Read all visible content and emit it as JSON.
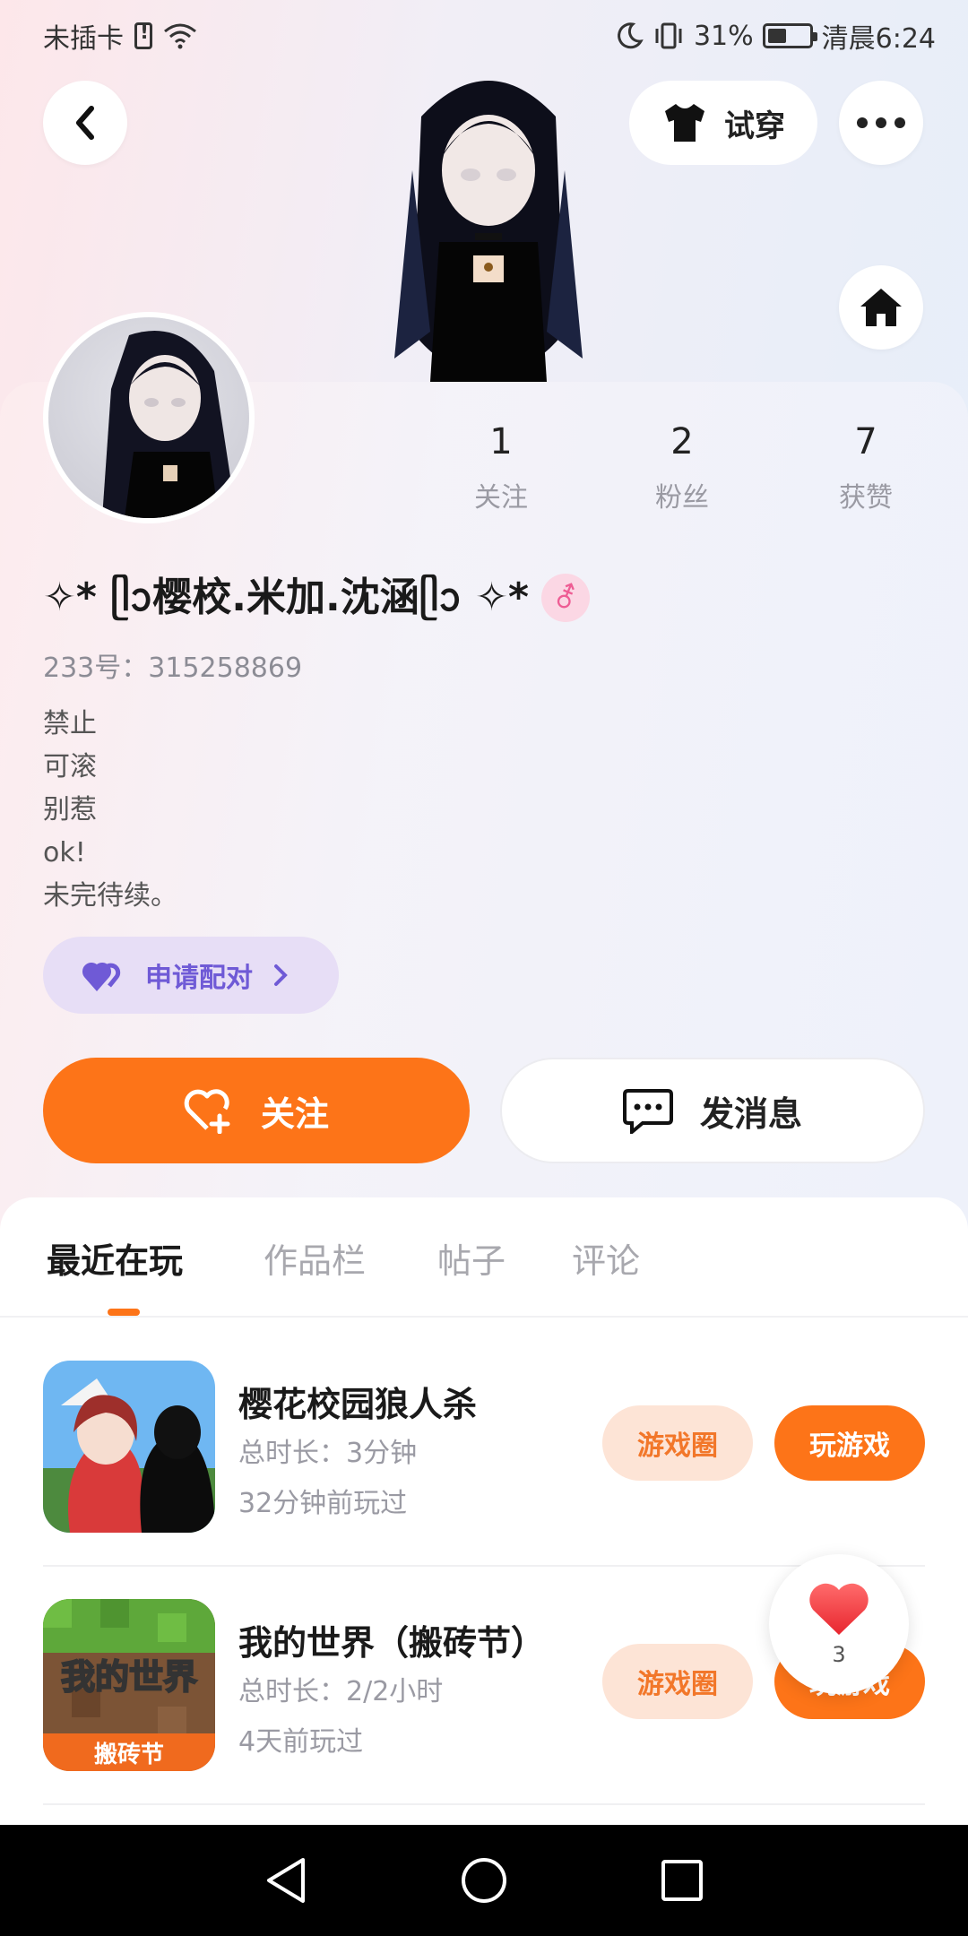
{
  "status_bar": {
    "carrier": "未插卡",
    "battery": "31%",
    "time": "清晨6:24"
  },
  "header": {
    "try_on_label": "试穿"
  },
  "stats": [
    {
      "value": "1",
      "label": "关注"
    },
    {
      "value": "2",
      "label": "粉丝"
    },
    {
      "value": "7",
      "label": "获赞"
    }
  ],
  "profile": {
    "name": "✧* ᥫᩣ樱校.米加.沈涵ᥫᩣ ✧*",
    "gender_symbol": "⚦",
    "id_line": "233号：315258869",
    "bio": [
      "禁止",
      "可滚",
      "别惹",
      "ok!",
      "未完待续。"
    ],
    "pair_label": "申请配对"
  },
  "actions": {
    "follow_label": "关注",
    "message_label": "发消息"
  },
  "tabs": [
    {
      "label": "最近在玩",
      "active": true
    },
    {
      "label": "作品栏",
      "active": false
    },
    {
      "label": "帖子",
      "active": false
    },
    {
      "label": "评论",
      "active": false
    }
  ],
  "games": [
    {
      "title": "樱花校园狼人杀",
      "duration": "总时长：3分钟",
      "last_played": "32分钟前玩过",
      "circle_label": "游戏圈",
      "play_label": "玩游戏"
    },
    {
      "title": "我的世界（搬砖节）",
      "duration": "总时长：2/2小时",
      "last_played": "4天前玩过",
      "circle_label": "游戏圈",
      "play_label": "玩游戏",
      "icon_text": "我的世界",
      "icon_badge": "搬砖节"
    }
  ],
  "like_float": {
    "count": "3"
  },
  "colors": {
    "accent": "#fd7418",
    "pair_purple": "#6f5ad6",
    "pill_light": "#fde4d6"
  }
}
